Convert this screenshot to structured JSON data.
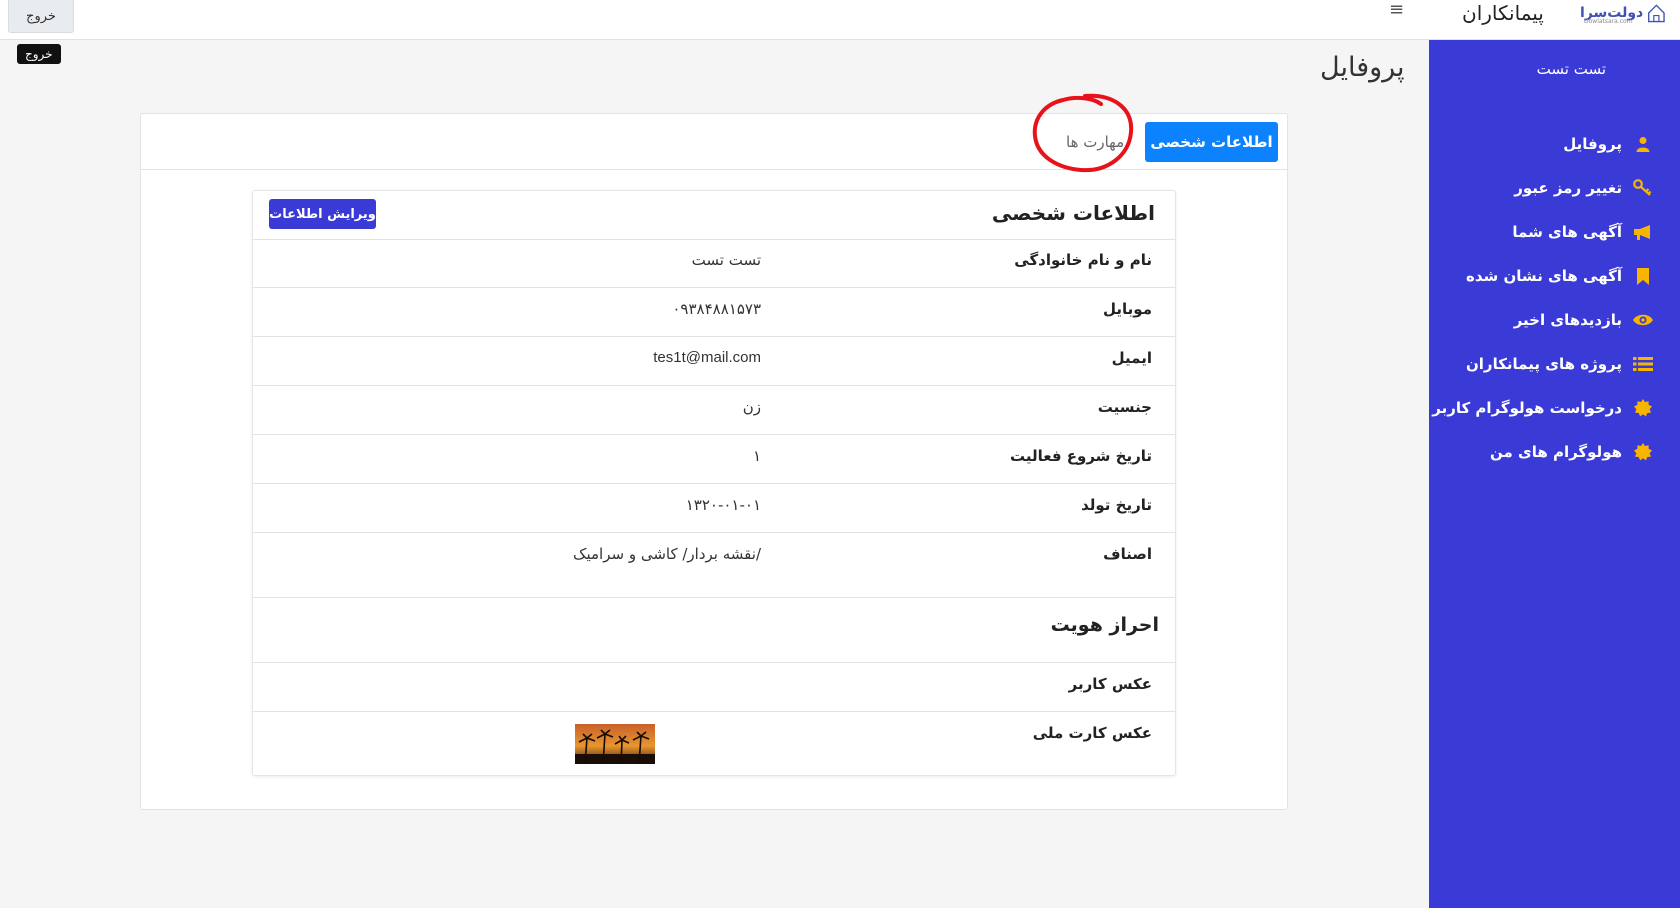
{
  "topbar": {
    "logout_label": "خروج",
    "logout_tooltip": "خروج",
    "menu_icon": "hamburger-icon",
    "brand_title": "پیمانکاران",
    "logo_text": "دولت‌سرا",
    "logo_sub": "Dowlatsara.com"
  },
  "sidebar": {
    "user_name": "تست تست",
    "items": [
      {
        "label": "پروفایل",
        "icon": "user-icon"
      },
      {
        "label": "تغییر رمز عبور",
        "icon": "key-icon"
      },
      {
        "label": "آگهی های شما",
        "icon": "bullhorn-icon"
      },
      {
        "label": "آگهی های نشان شده",
        "icon": "bookmark-icon"
      },
      {
        "label": "بازدیدهای اخیر",
        "icon": "eye-icon"
      },
      {
        "label": "پروژه های پیمانکاران",
        "icon": "list-icon"
      },
      {
        "label": "درخواست هولوگرام کاربر",
        "icon": "badge-icon"
      },
      {
        "label": "هولوگرام های من",
        "icon": "badge-icon"
      }
    ]
  },
  "page": {
    "title": "پروفایل"
  },
  "tabs": {
    "personal": "اطلاعات شخصی",
    "skills": "مهارت ها"
  },
  "personal_info": {
    "title": "اطلاعات شخصی",
    "edit_label": "ویرایش اطلاعات",
    "rows": [
      {
        "label": "نام و نام خانوادگی",
        "value": "تست تست"
      },
      {
        "label": "موبایل",
        "value": "۰۹۳۸۴۸۸۱۵۷۳"
      },
      {
        "label": "ایمیل",
        "value": "tes1t@mail.com"
      },
      {
        "label": "جنسیت",
        "value": "زن"
      },
      {
        "label": "تاریخ شروع فعالیت",
        "value": "۱"
      },
      {
        "label": "تاریخ تولد",
        "value": "۱۳۲۰-۰۱-۰۱"
      },
      {
        "label": "اصناف",
        "value": "نقشه بردار/ کاشی و سرامیک/"
      }
    ]
  },
  "identity": {
    "title": "احراز هویت",
    "user_photo_label": "عکس کاربر",
    "national_card_label": "عکس کارت ملی"
  },
  "colors": {
    "sidebar_bg": "#3a3ad6",
    "primary": "#0d82ff",
    "icon_accent": "#f7b500",
    "annotation": "#e8121b"
  }
}
